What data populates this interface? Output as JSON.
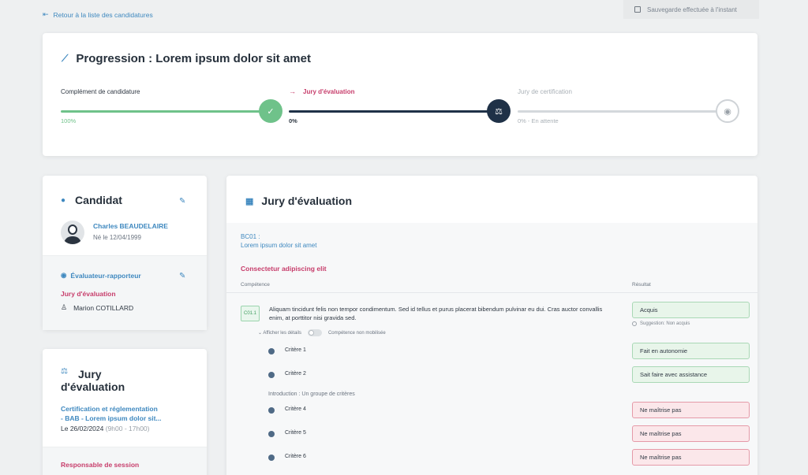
{
  "topbar": {
    "back_link": "Retour à la liste des candidatures",
    "save_status": "Sauvegarde effectuée à l'instant"
  },
  "progress": {
    "title": "Progression : Lorem ipsum dolor sit amet",
    "steps": [
      {
        "label": "Complément de candidature",
        "status_text": "100%",
        "state": "done"
      },
      {
        "label": "Jury d'évaluation",
        "status_text": "0%",
        "state": "active"
      },
      {
        "label": "Jury de certification",
        "status_text": "0% - En attente",
        "state": "pending"
      }
    ]
  },
  "candidate": {
    "title": "Candidat",
    "name": "Charles BEAUDELAIRE",
    "birth": "Né le 12/04/1999",
    "evaluator_title": "Évaluateur-rapporteur",
    "evaluator_role": "Jury d'évaluation",
    "evaluator_name": "Marion COTILLARD"
  },
  "jury_card": {
    "title_line1": "Jury",
    "title_line2": "d'évaluation",
    "cert_line1": "Certification et réglementation",
    "cert_line2": "- BAB - Lorem ipsum dolor sit...",
    "date": "Le 26/02/2024",
    "time": "(9h00 - 17h00)",
    "session_title": "Responsable de session"
  },
  "main": {
    "title": "Jury d'évaluation",
    "bc_code": "BC01 :",
    "bc_name": "Lorem ipsum dolor sit amet",
    "block_title": "Consectetur adipiscing elit",
    "col_competence": "Compétence",
    "col_result": "Résultat",
    "competence": {
      "badge": "C01.1",
      "text": "Aliquam tincidunt felis non tempor condimentum. Sed id tellus et purus placerat bibendum pulvinar eu dui. Cras auctor convallis enim, at porttitor nisi gravida sed.",
      "result": "Acquis",
      "suggestion": "Suggestion: Non acquis",
      "details_label": "Afficher les détails",
      "toggle_label": "Compétence non mobilisée"
    },
    "group_label": "Introduction : Un groupe de critères",
    "criteria": [
      {
        "label": "Critère 1",
        "result": "Fait en autonomie",
        "tone": "green"
      },
      {
        "label": "Critère 2",
        "result": "Sait faire avec assistance",
        "tone": "green"
      },
      {
        "label": "Critère 4",
        "result": "Ne maîtrise pas",
        "tone": "red"
      },
      {
        "label": "Critère 5",
        "result": "Ne maîtrise pas",
        "tone": "red"
      },
      {
        "label": "Critère 6",
        "result": "Ne maîtrise pas",
        "tone": "red"
      }
    ]
  },
  "colors": {
    "accent": "#3e88bf",
    "pink": "#c73d6b",
    "done": "#6fc28a",
    "active": "#1f3147"
  }
}
